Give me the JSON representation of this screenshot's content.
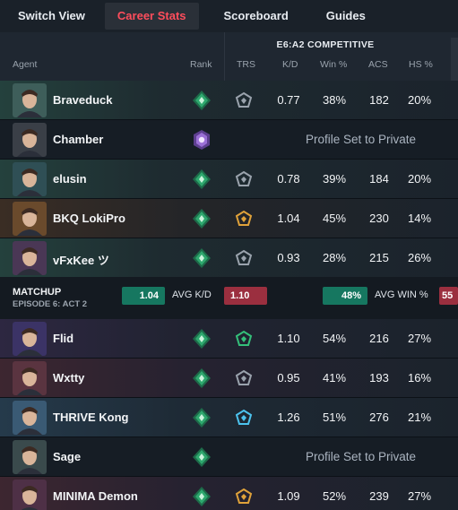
{
  "tabs": [
    {
      "label": "Switch View",
      "active": false
    },
    {
      "label": "Career Stats",
      "active": true
    },
    {
      "label": "Scoreboard",
      "active": false
    },
    {
      "label": "Guides",
      "active": false
    }
  ],
  "header": {
    "season": "E6:A2 COMPETITIVE",
    "columns": {
      "agent": "Agent",
      "rank": "Rank",
      "trs": "TRS",
      "kd": "K/D",
      "win": "Win %",
      "acs": "ACS",
      "hs": "HS %"
    }
  },
  "team_top": [
    {
      "name": "Braveduck",
      "rank_icon": "ascendant-rank-icon",
      "trs_icon": "iron-trs-icon",
      "kd": "0.77",
      "win": "38%",
      "acs": "182",
      "hs": "20%"
    },
    {
      "name": "Chamber",
      "rank_icon": "radiant-rank-icon",
      "private": "Profile Set to Private"
    },
    {
      "name": "elusin",
      "rank_icon": "ascendant-rank-icon",
      "trs_icon": "iron-trs-icon",
      "kd": "0.78",
      "win": "39%",
      "acs": "184",
      "hs": "20%"
    },
    {
      "name": "BKQ LokiPro",
      "rank_icon": "ascendant-rank-icon",
      "trs_icon": "gold-trs-icon",
      "kd": "1.04",
      "win": "45%",
      "acs": "230",
      "hs": "14%"
    },
    {
      "name": "vFxKee ツ",
      "rank_icon": "ascendant-rank-icon",
      "trs_icon": "iron-trs-icon",
      "kd": "0.93",
      "win": "28%",
      "acs": "215",
      "hs": "26%"
    }
  ],
  "matchup": {
    "title": "MATCHUP",
    "subtitle": "EPISODE 6: ACT 2",
    "avg_kd_left": "1.04",
    "avg_kd_label": "AVG K/D",
    "avg_kd_right": "1.10",
    "avg_win_left": "48%",
    "avg_win_label": "AVG WIN %",
    "avg_win_right": "55"
  },
  "team_bottom": [
    {
      "name": "Flid",
      "rank_icon": "ascendant-rank-icon",
      "trs_icon": "emerald-trs-icon",
      "kd": "1.10",
      "win": "54%",
      "acs": "216",
      "hs": "27%"
    },
    {
      "name": "Wxtty",
      "rank_icon": "ascendant-rank-icon",
      "trs_icon": "iron-trs-icon",
      "kd": "0.95",
      "win": "41%",
      "acs": "193",
      "hs": "16%"
    },
    {
      "name": "THRIVE Kong",
      "rank_icon": "ascendant-rank-icon",
      "trs_icon": "diamond-trs-icon",
      "kd": "1.26",
      "win": "51%",
      "acs": "276",
      "hs": "21%"
    },
    {
      "name": "Sage",
      "rank_icon": "ascendant-rank-icon",
      "private": "Profile Set to Private"
    },
    {
      "name": "MINIMA Demon",
      "rank_icon": "ascendant-rank-icon",
      "trs_icon": "gold-trs-icon",
      "kd": "1.09",
      "win": "52%",
      "acs": "239",
      "hs": "27%"
    }
  ],
  "colors": {
    "accent_red": "#ff4d5c",
    "pill_green": "#167760",
    "pill_red": "#9b2f3f",
    "rank_ascendant": "#2ea86e",
    "rank_radiant": "#9b6fd6",
    "trs_gold": "#e0a23a",
    "trs_emerald": "#34c07a",
    "trs_diamond": "#4cc3ee",
    "trs_iron": "#9aa3ad"
  }
}
